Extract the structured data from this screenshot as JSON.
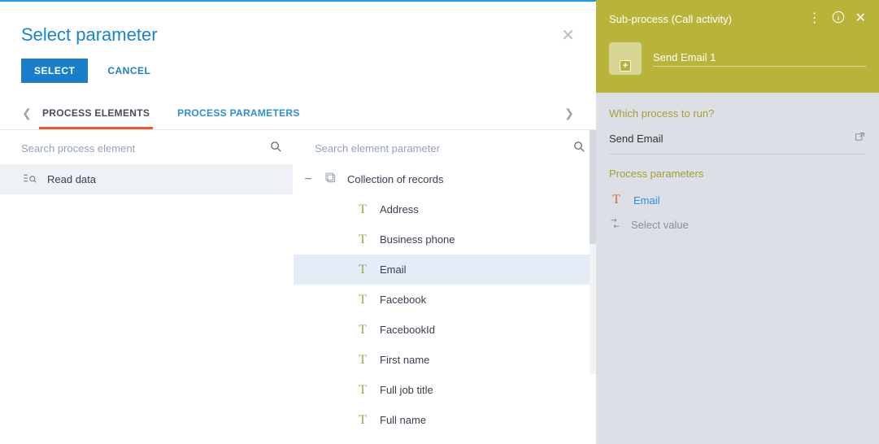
{
  "modal": {
    "title": "Select parameter",
    "select_label": "SELECT",
    "cancel_label": "CANCEL",
    "tabs": {
      "process_elements": "PROCESS ELEMENTS",
      "process_parameters": "PROCESS PARAMETERS"
    },
    "left": {
      "search_placeholder": "Search process element",
      "items": [
        {
          "label": "Read data"
        }
      ]
    },
    "right": {
      "search_placeholder": "Search element parameter",
      "root_label": "Collection of records",
      "children": [
        "Address",
        "Business phone",
        "Email",
        "Facebook",
        "FacebookId",
        "First name",
        "Full job title",
        "Full name"
      ],
      "selected_index": 2
    }
  },
  "sidebar": {
    "title": "Sub-process (Call activity)",
    "element_name": "Send Email 1",
    "section_process": "Which process to run?",
    "process_value": "Send Email",
    "section_params": "Process parameters",
    "params": {
      "email_label": "Email",
      "select_value_label": "Select value"
    }
  }
}
